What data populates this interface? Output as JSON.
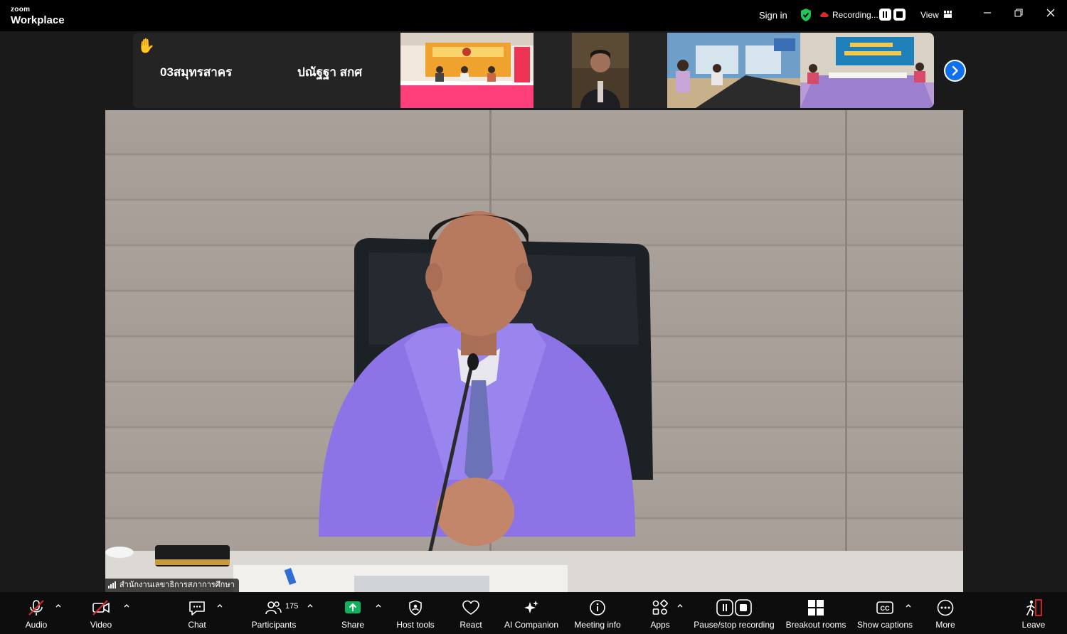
{
  "app": {
    "brand_small": "zoom",
    "brand_name": "Workplace",
    "sign_in": "Sign in",
    "recording_label": "Recording...",
    "view_label": "View"
  },
  "gallery": {
    "names": [
      "03สมุทรสาคร",
      "ปณัฐฐา สกศ"
    ],
    "raised_hand": true
  },
  "main_video": {
    "speaker_label": "สำนักงานเลขาธิการสภาการศึกษา"
  },
  "toolbar": {
    "audio": "Audio",
    "video": "Video",
    "chat": "Chat",
    "participants": "Participants",
    "participants_count": "175",
    "share": "Share",
    "host_tools": "Host tools",
    "react": "React",
    "ai_companion": "AI Companion",
    "meeting_info": "Meeting info",
    "apps": "Apps",
    "pause_stop_recording": "Pause/stop recording",
    "breakout_rooms": "Breakout rooms",
    "show_captions": "Show captions",
    "more": "More",
    "leave": "Leave"
  },
  "colors": {
    "accent_blue": "#0e71eb",
    "share_green": "#0fb15c",
    "muted_red": "#e02828",
    "secure_green": "#1ec45c"
  }
}
